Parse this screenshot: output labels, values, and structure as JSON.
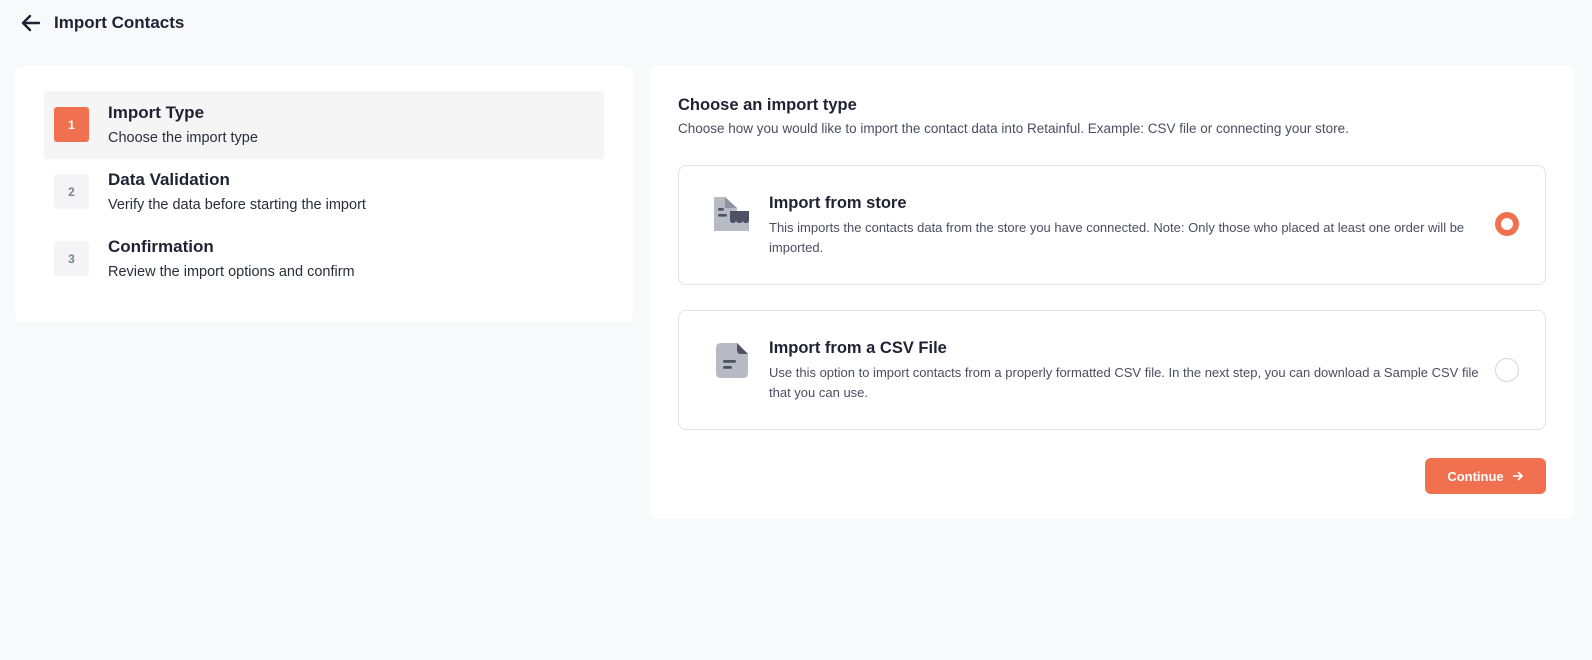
{
  "header": {
    "title": "Import Contacts",
    "back_icon": "arrow-left-icon"
  },
  "steps": [
    {
      "number": "1",
      "title": "Import Type",
      "description": "Choose the import type",
      "active": true
    },
    {
      "number": "2",
      "title": "Data Validation",
      "description": "Verify the data before starting the import",
      "active": false
    },
    {
      "number": "3",
      "title": "Confirmation",
      "description": "Review the import options and confirm",
      "active": false
    }
  ],
  "main": {
    "title": "Choose an import type",
    "description": "Choose how you would like to import the contact data into Retainful. Example: CSV file or connecting your store.",
    "options": [
      {
        "title": "Import from store",
        "description": "This imports the contacts data from the store you have connected. Note: Only those who placed at least one order will be imported.",
        "icon": "store-icon",
        "selected": true
      },
      {
        "title": "Import from a CSV File",
        "description": "Use this option to import contacts from a properly formatted CSV file. In the next step, you can download a Sample CSV file that you can use.",
        "icon": "csv-file-icon",
        "selected": false
      }
    ],
    "continue_label": "Continue",
    "continue_icon": "arrow-right-icon"
  },
  "colors": {
    "accent": "#f0704f",
    "background": "#f8f9fb",
    "text": "#1f2233"
  }
}
